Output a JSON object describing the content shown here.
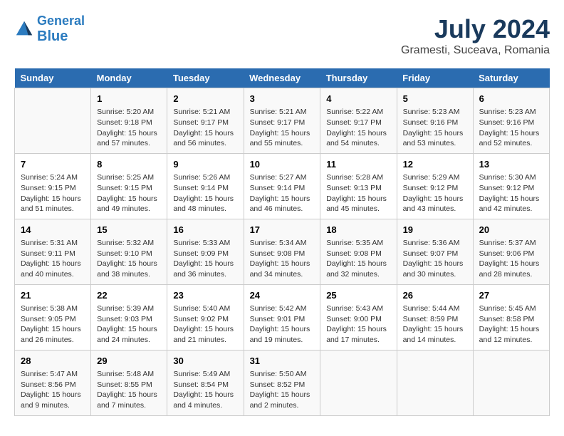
{
  "header": {
    "logo_line1": "General",
    "logo_line2": "Blue",
    "title": "July 2024",
    "subtitle": "Gramesti, Suceava, Romania"
  },
  "columns": [
    "Sunday",
    "Monday",
    "Tuesday",
    "Wednesday",
    "Thursday",
    "Friday",
    "Saturday"
  ],
  "weeks": [
    [
      {
        "day": "",
        "sunrise": "",
        "sunset": "",
        "daylight": ""
      },
      {
        "day": "1",
        "sunrise": "Sunrise: 5:20 AM",
        "sunset": "Sunset: 9:18 PM",
        "daylight": "Daylight: 15 hours and 57 minutes."
      },
      {
        "day": "2",
        "sunrise": "Sunrise: 5:21 AM",
        "sunset": "Sunset: 9:17 PM",
        "daylight": "Daylight: 15 hours and 56 minutes."
      },
      {
        "day": "3",
        "sunrise": "Sunrise: 5:21 AM",
        "sunset": "Sunset: 9:17 PM",
        "daylight": "Daylight: 15 hours and 55 minutes."
      },
      {
        "day": "4",
        "sunrise": "Sunrise: 5:22 AM",
        "sunset": "Sunset: 9:17 PM",
        "daylight": "Daylight: 15 hours and 54 minutes."
      },
      {
        "day": "5",
        "sunrise": "Sunrise: 5:23 AM",
        "sunset": "Sunset: 9:16 PM",
        "daylight": "Daylight: 15 hours and 53 minutes."
      },
      {
        "day": "6",
        "sunrise": "Sunrise: 5:23 AM",
        "sunset": "Sunset: 9:16 PM",
        "daylight": "Daylight: 15 hours and 52 minutes."
      }
    ],
    [
      {
        "day": "7",
        "sunrise": "Sunrise: 5:24 AM",
        "sunset": "Sunset: 9:15 PM",
        "daylight": "Daylight: 15 hours and 51 minutes."
      },
      {
        "day": "8",
        "sunrise": "Sunrise: 5:25 AM",
        "sunset": "Sunset: 9:15 PM",
        "daylight": "Daylight: 15 hours and 49 minutes."
      },
      {
        "day": "9",
        "sunrise": "Sunrise: 5:26 AM",
        "sunset": "Sunset: 9:14 PM",
        "daylight": "Daylight: 15 hours and 48 minutes."
      },
      {
        "day": "10",
        "sunrise": "Sunrise: 5:27 AM",
        "sunset": "Sunset: 9:14 PM",
        "daylight": "Daylight: 15 hours and 46 minutes."
      },
      {
        "day": "11",
        "sunrise": "Sunrise: 5:28 AM",
        "sunset": "Sunset: 9:13 PM",
        "daylight": "Daylight: 15 hours and 45 minutes."
      },
      {
        "day": "12",
        "sunrise": "Sunrise: 5:29 AM",
        "sunset": "Sunset: 9:12 PM",
        "daylight": "Daylight: 15 hours and 43 minutes."
      },
      {
        "day": "13",
        "sunrise": "Sunrise: 5:30 AM",
        "sunset": "Sunset: 9:12 PM",
        "daylight": "Daylight: 15 hours and 42 minutes."
      }
    ],
    [
      {
        "day": "14",
        "sunrise": "Sunrise: 5:31 AM",
        "sunset": "Sunset: 9:11 PM",
        "daylight": "Daylight: 15 hours and 40 minutes."
      },
      {
        "day": "15",
        "sunrise": "Sunrise: 5:32 AM",
        "sunset": "Sunset: 9:10 PM",
        "daylight": "Daylight: 15 hours and 38 minutes."
      },
      {
        "day": "16",
        "sunrise": "Sunrise: 5:33 AM",
        "sunset": "Sunset: 9:09 PM",
        "daylight": "Daylight: 15 hours and 36 minutes."
      },
      {
        "day": "17",
        "sunrise": "Sunrise: 5:34 AM",
        "sunset": "Sunset: 9:08 PM",
        "daylight": "Daylight: 15 hours and 34 minutes."
      },
      {
        "day": "18",
        "sunrise": "Sunrise: 5:35 AM",
        "sunset": "Sunset: 9:08 PM",
        "daylight": "Daylight: 15 hours and 32 minutes."
      },
      {
        "day": "19",
        "sunrise": "Sunrise: 5:36 AM",
        "sunset": "Sunset: 9:07 PM",
        "daylight": "Daylight: 15 hours and 30 minutes."
      },
      {
        "day": "20",
        "sunrise": "Sunrise: 5:37 AM",
        "sunset": "Sunset: 9:06 PM",
        "daylight": "Daylight: 15 hours and 28 minutes."
      }
    ],
    [
      {
        "day": "21",
        "sunrise": "Sunrise: 5:38 AM",
        "sunset": "Sunset: 9:05 PM",
        "daylight": "Daylight: 15 hours and 26 minutes."
      },
      {
        "day": "22",
        "sunrise": "Sunrise: 5:39 AM",
        "sunset": "Sunset: 9:03 PM",
        "daylight": "Daylight: 15 hours and 24 minutes."
      },
      {
        "day": "23",
        "sunrise": "Sunrise: 5:40 AM",
        "sunset": "Sunset: 9:02 PM",
        "daylight": "Daylight: 15 hours and 21 minutes."
      },
      {
        "day": "24",
        "sunrise": "Sunrise: 5:42 AM",
        "sunset": "Sunset: 9:01 PM",
        "daylight": "Daylight: 15 hours and 19 minutes."
      },
      {
        "day": "25",
        "sunrise": "Sunrise: 5:43 AM",
        "sunset": "Sunset: 9:00 PM",
        "daylight": "Daylight: 15 hours and 17 minutes."
      },
      {
        "day": "26",
        "sunrise": "Sunrise: 5:44 AM",
        "sunset": "Sunset: 8:59 PM",
        "daylight": "Daylight: 15 hours and 14 minutes."
      },
      {
        "day": "27",
        "sunrise": "Sunrise: 5:45 AM",
        "sunset": "Sunset: 8:58 PM",
        "daylight": "Daylight: 15 hours and 12 minutes."
      }
    ],
    [
      {
        "day": "28",
        "sunrise": "Sunrise: 5:47 AM",
        "sunset": "Sunset: 8:56 PM",
        "daylight": "Daylight: 15 hours and 9 minutes."
      },
      {
        "day": "29",
        "sunrise": "Sunrise: 5:48 AM",
        "sunset": "Sunset: 8:55 PM",
        "daylight": "Daylight: 15 hours and 7 minutes."
      },
      {
        "day": "30",
        "sunrise": "Sunrise: 5:49 AM",
        "sunset": "Sunset: 8:54 PM",
        "daylight": "Daylight: 15 hours and 4 minutes."
      },
      {
        "day": "31",
        "sunrise": "Sunrise: 5:50 AM",
        "sunset": "Sunset: 8:52 PM",
        "daylight": "Daylight: 15 hours and 2 minutes."
      },
      {
        "day": "",
        "sunrise": "",
        "sunset": "",
        "daylight": ""
      },
      {
        "day": "",
        "sunrise": "",
        "sunset": "",
        "daylight": ""
      },
      {
        "day": "",
        "sunrise": "",
        "sunset": "",
        "daylight": ""
      }
    ]
  ]
}
